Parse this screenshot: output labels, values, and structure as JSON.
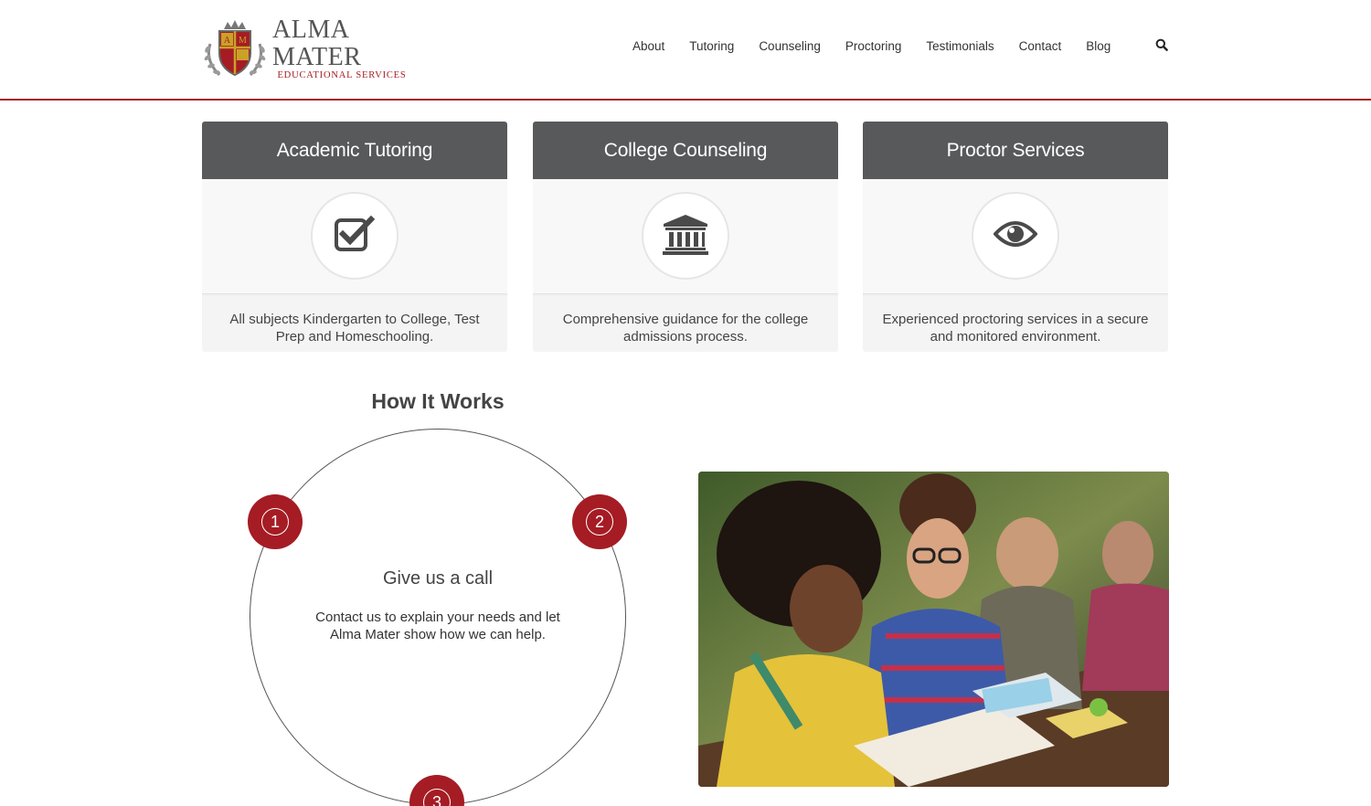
{
  "brand": {
    "name": "ALMA MATER",
    "subtitle": "EDUCATIONAL SERVICES",
    "crest_letters": [
      "A",
      "M"
    ]
  },
  "nav": {
    "items": [
      "About",
      "Tutoring",
      "Counseling",
      "Proctoring",
      "Testimonials",
      "Contact",
      "Blog"
    ],
    "search_icon": "search-icon"
  },
  "services": [
    {
      "title": "Academic Tutoring",
      "icon": "checkbox-icon",
      "description": "All subjects Kindergarten to College, Test Prep and Homeschooling."
    },
    {
      "title": "College Counseling",
      "icon": "institution-icon",
      "description": "Comprehensive guidance for the college admissions process."
    },
    {
      "title": "Proctor Services",
      "icon": "eye-icon",
      "description": "Experienced proctoring services in a secure and monitored environment."
    }
  ],
  "how_it_works": {
    "title": "How It Works",
    "steps": [
      "1",
      "2",
      "3"
    ],
    "active_step": {
      "title": "Give us a call",
      "text": "Contact us to explain your needs and let Alma Mater show how we can help."
    }
  },
  "colors": {
    "accent": "#a51c24",
    "card_header": "#58595b",
    "card_body": "#f4f4f4"
  }
}
